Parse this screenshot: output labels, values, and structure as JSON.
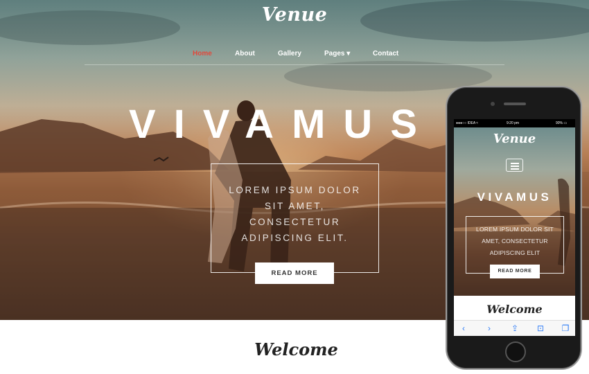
{
  "site": {
    "logo": "Venue",
    "nav": [
      {
        "label": "Home",
        "active": true
      },
      {
        "label": "About",
        "active": false
      },
      {
        "label": "Gallery",
        "active": false
      },
      {
        "label": "Pages ▾",
        "active": false
      },
      {
        "label": "Contact",
        "active": false
      }
    ],
    "hero": {
      "title": "VIVAMUS",
      "lines": [
        "LOREM IPSUM DOLOR",
        "SIT AMET,",
        "CONSECTETUR",
        "ADIPISCING ELIT."
      ],
      "button": "READ MORE"
    },
    "welcome": "Welcome"
  },
  "phone": {
    "status": {
      "carrier": "●●●○○ IDEA ≈",
      "time": "9:20 pm",
      "battery": "90% ▭"
    },
    "logo": "Venue",
    "title": "VIVAMUS",
    "lines": [
      "LOREM IPSUM DOLOR SIT",
      "AMET, CONSECTETUR",
      "ADIPISCING ELIT"
    ],
    "button": "READ MORE",
    "welcome": "Welcome",
    "toolbar": [
      "‹",
      "›",
      "⇪",
      "⊡",
      "❐"
    ]
  },
  "colors": {
    "accent": "#e2483a",
    "ios_blue": "#2f7cf6"
  }
}
